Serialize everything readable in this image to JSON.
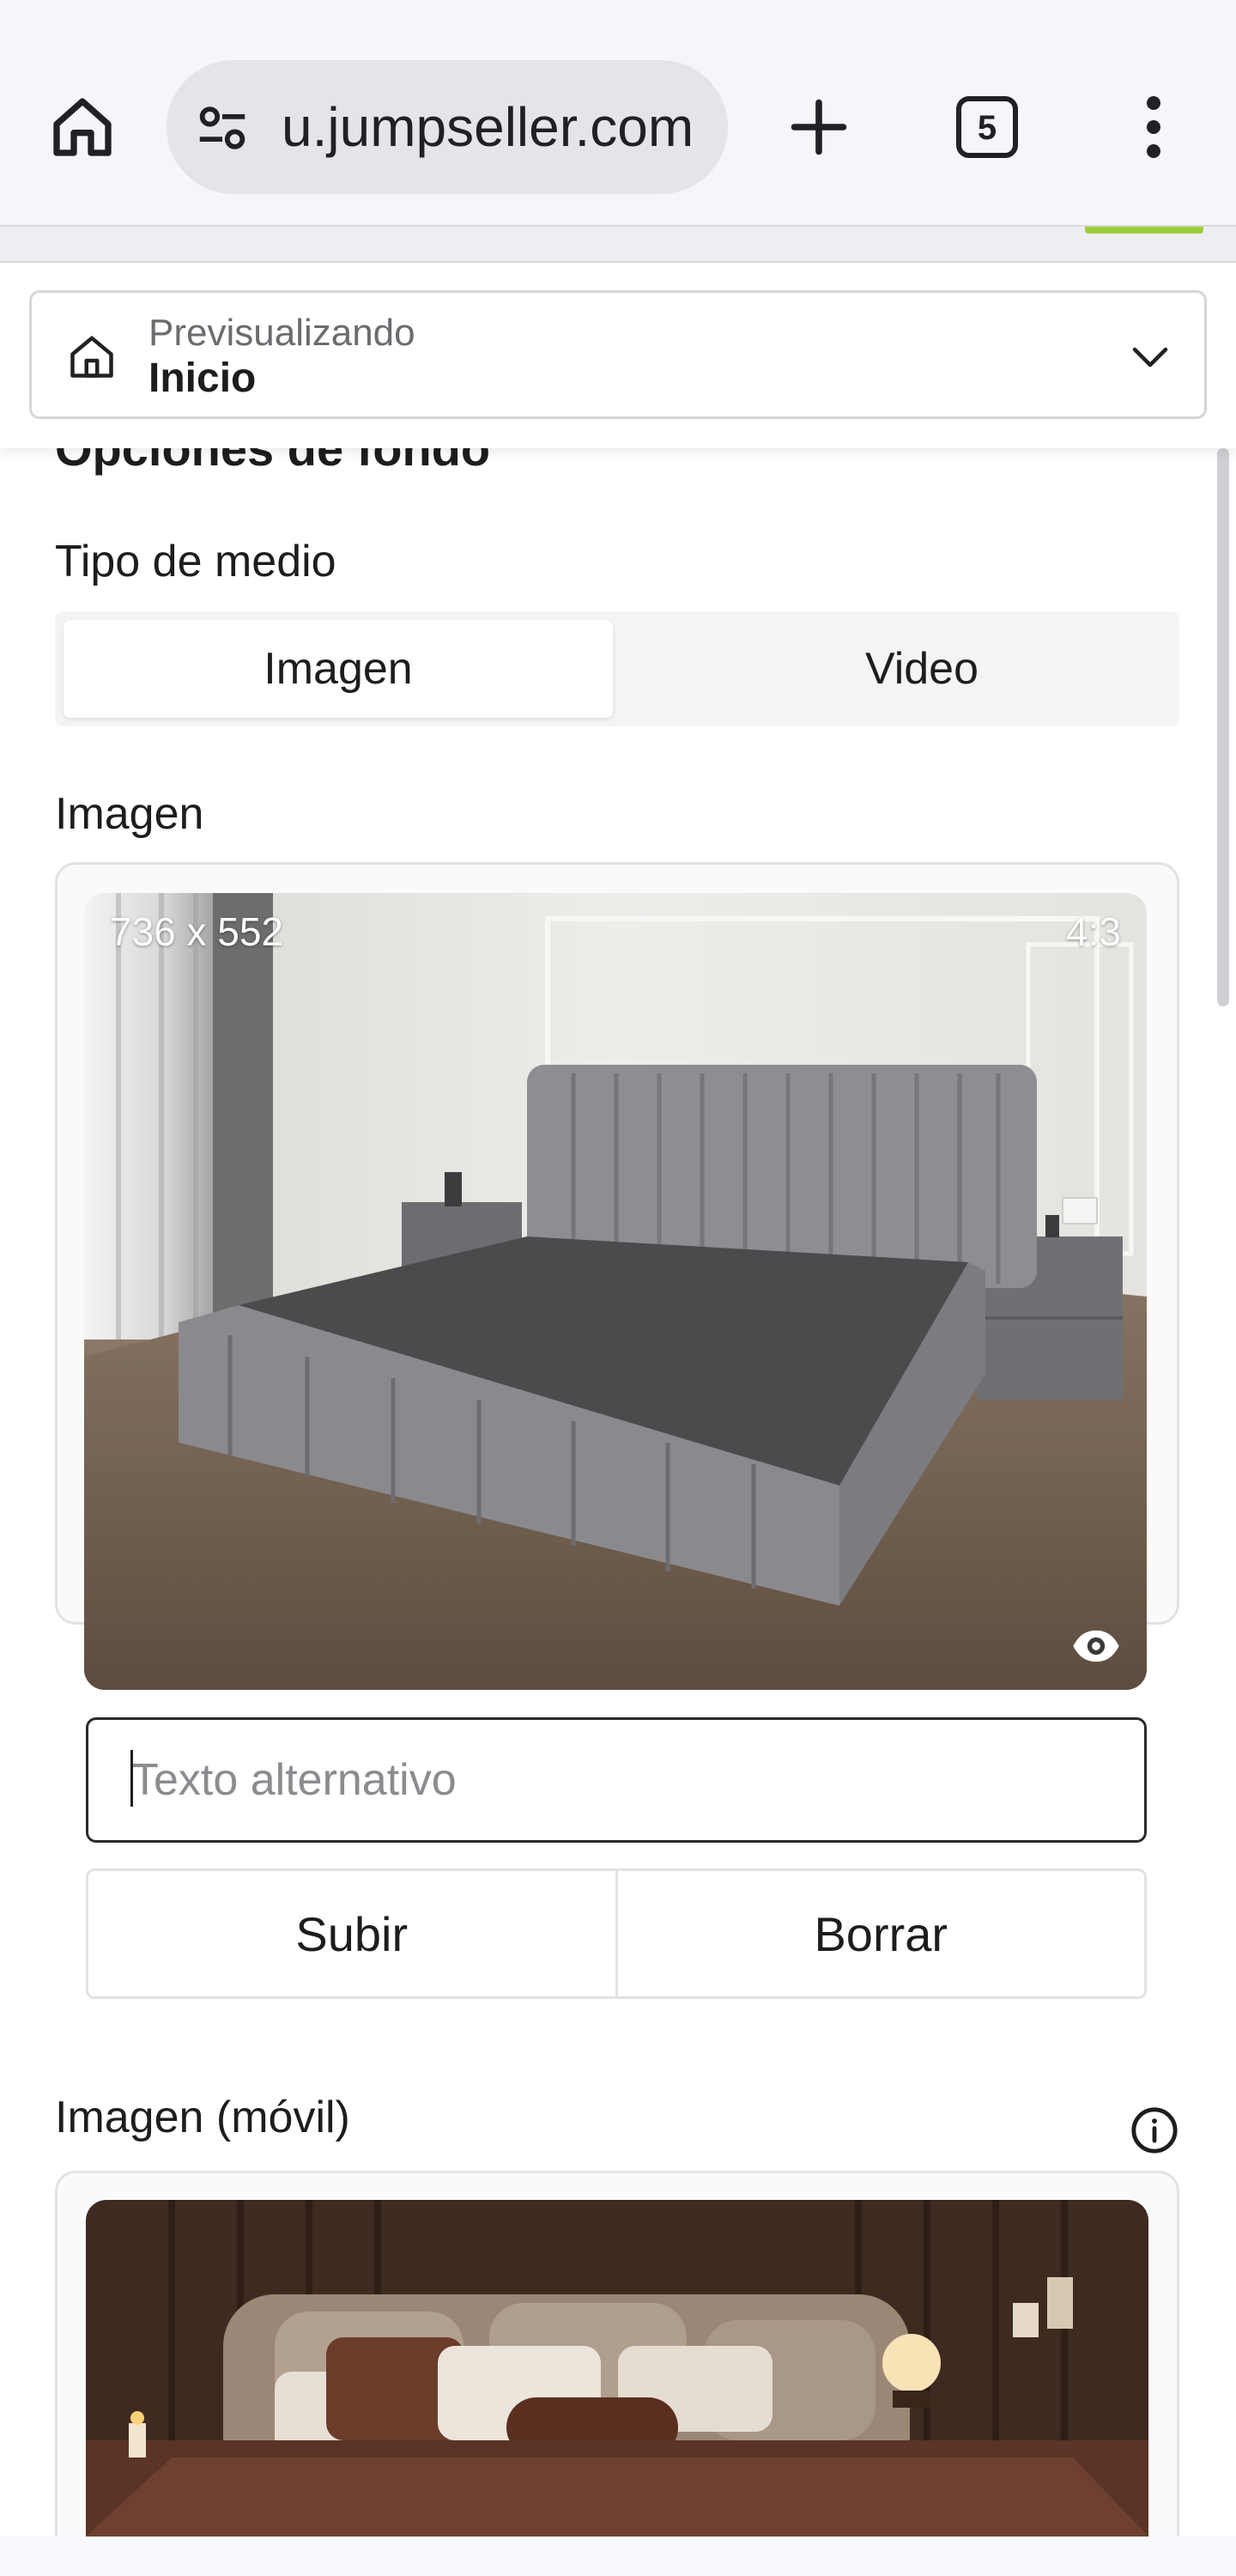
{
  "browser": {
    "url": "u.jumpseller.com",
    "tab_count": "5"
  },
  "preview": {
    "caption": "Previsualizando",
    "value": "Inicio"
  },
  "settings": {
    "section_title": "Opciones de fondo",
    "media_type_label": "Tipo de medio",
    "media_options": [
      "Imagen",
      "Video"
    ],
    "media_selected": "Imagen",
    "image_label": "Imagen",
    "image_dimensions": "736 x 552",
    "image_ratio": "4:3",
    "alt_placeholder": "Texto alternativo",
    "upload_label": "Subir",
    "delete_label": "Borrar",
    "mobile_image_label": "Imagen (móvil)"
  },
  "icons": {
    "home": "home-icon",
    "tune": "tune-icon",
    "new_tab": "plus-icon",
    "tabs": "tab-count-icon",
    "menu": "more-vertical-icon",
    "preview_house": "house-icon",
    "chevron": "chevron-down-icon",
    "eye": "eye-icon",
    "info": "info-icon"
  },
  "colors": {
    "accent_green": "#9ccc3c"
  }
}
